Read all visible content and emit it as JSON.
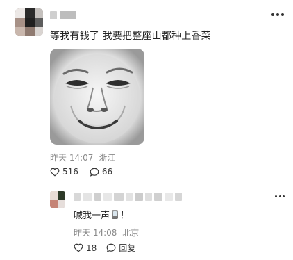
{
  "comment": {
    "text": "等我有钱了 我要把整座山都种上香菜",
    "time": "昨天 14:07",
    "location": "浙江",
    "likes": "516",
    "replies": "66"
  },
  "reply": {
    "text_before": "喊我一声",
    "text_after": "！",
    "time": "昨天 14:08",
    "location": "北京",
    "likes": "18",
    "reply_label": "回复"
  },
  "icons": {
    "like": "heart-outline-icon",
    "comment": "speech-bubble-icon",
    "more": "more-dots-icon",
    "phone_emoji": "mobile-phone-icon"
  },
  "colors": {
    "meta_gray": "#8a8a8a",
    "text": "#222222"
  }
}
